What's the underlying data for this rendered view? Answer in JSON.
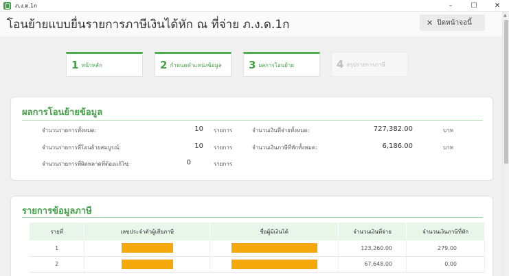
{
  "window": {
    "title": "ภ.ง.ด.1ก",
    "controls": [
      "–",
      "☐",
      "✕"
    ]
  },
  "header": {
    "title": "โอนย้ายแบบยื่นรายการภาษีเงินได้หัก ณ ที่จ่าย ภ.ง.ด.1ก",
    "close_button": "ปิดหน้าจอนี้"
  },
  "steps": [
    {
      "num": "1",
      "label": "หน้าหลัก",
      "state": "done"
    },
    {
      "num": "2",
      "label": "กำหนดตำแหน่งข้อมูล",
      "state": "done"
    },
    {
      "num": "3",
      "label": "ผลการโอนย้าย",
      "state": "current"
    },
    {
      "num": "4",
      "label": "สรุปรายการภาษี",
      "state": "disabled"
    }
  ],
  "summary": {
    "title": "ผลการโอนย้ายข้อมูล",
    "left": [
      {
        "label": "จำนวนรายการทั้งหมด:",
        "value": "10",
        "unit": "รายการ"
      },
      {
        "label": "จำนวนรายการที่โอนย้ายสมบูรณ์:",
        "value": "10",
        "unit": "รายการ"
      },
      {
        "label": "จำนวนรายการที่ผิดพลาดที่ต้องแก้ไข:",
        "value": "0",
        "unit": "รายการ"
      }
    ],
    "right": [
      {
        "label": "จำนวนเงินที่จ่ายทั้งหมด:",
        "value": "727,382.00",
        "unit": "บาท"
      },
      {
        "label": "จำนวนเงินภาษีที่หักทั้งหมด:",
        "value": "6,186.00",
        "unit": "บาท"
      }
    ]
  },
  "tax_list": {
    "title": "รายการข้อมูลภาษี",
    "headers": [
      "รายที่",
      "เลขประจำตัวผู้เสียภาษี",
      "ชื่อผู้มีเงินได้",
      "จำนวนเงินที่จ่าย",
      "จำนวนเงินภาษีที่หัก"
    ],
    "rows": [
      {
        "no": "1",
        "amount": "123,260.00",
        "tax": "279.00"
      },
      {
        "no": "2",
        "amount": "67,648.00",
        "tax": "0.00"
      }
    ]
  },
  "colors": {
    "accent": "#43a047",
    "redaction": "#f5a80c"
  }
}
